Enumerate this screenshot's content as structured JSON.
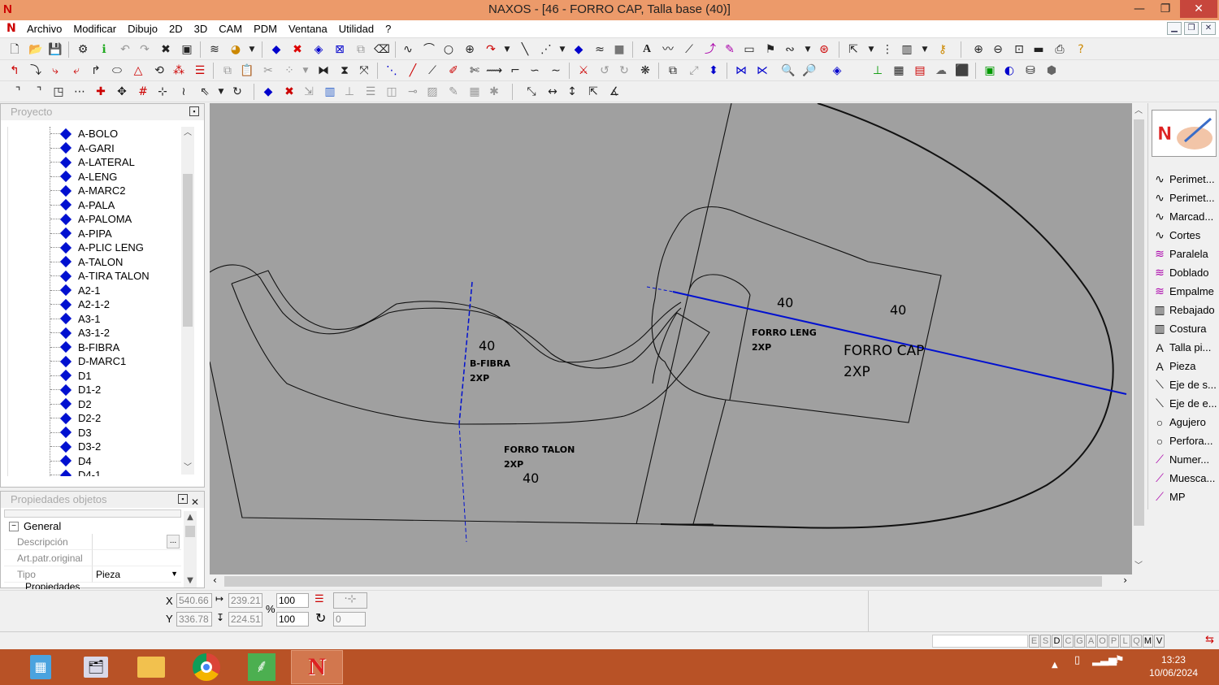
{
  "window": {
    "app_logo": "N",
    "title": "NAXOS - [46 - FORRO CAP, Talla base (40)]",
    "minimize": "—",
    "maximize": "❐",
    "close": "✕"
  },
  "menu": {
    "items": [
      "Archivo",
      "Modificar",
      "Dibujo",
      "2D",
      "3D",
      "CAM",
      "PDM",
      "Ventana",
      "Utilidad",
      "?"
    ]
  },
  "project_panel": {
    "title": "Proyecto",
    "items": [
      "A-BOLO",
      "A-GARI",
      "A-LATERAL",
      "A-LENG",
      "A-MARC2",
      "A-PALA",
      "A-PALOMA",
      "A-PIPA",
      "A-PLIC LENG",
      "A-TALON",
      "A-TIRA TALON",
      "A2-1",
      "A2-1-2",
      "A3-1",
      "A3-1-2",
      "B-FIBRA",
      "D-MARC1",
      "D1",
      "D1-2",
      "D2",
      "D2-2",
      "D3",
      "D3-2",
      "D4",
      "D4-1"
    ]
  },
  "properties_panel": {
    "title": "Propiedades objetos",
    "section": "General",
    "rows": [
      {
        "key": "Descripción",
        "value": ""
      },
      {
        "key": "Art.patr.original",
        "value": ""
      },
      {
        "key": "Tipo",
        "value": "Pieza"
      }
    ],
    "cut_row": "Propiedades"
  },
  "canvas_labels": {
    "bfibra_size": "40",
    "bfibra_name": "B-FIBRA",
    "bfibra_qty": "2XP",
    "talon_name": "FORRO TALON",
    "talon_qty": "2XP",
    "talon_size": "40",
    "leng_size": "40",
    "leng_name": "FORRO LENG",
    "leng_qty": "2XP",
    "cap_size": "40",
    "cap_name": "FORRO CAP",
    "cap_qty": "2XP"
  },
  "right_panel": {
    "items": [
      "Perimet...",
      "Perimet...",
      "Marcad...",
      "Cortes",
      "Paralela",
      "Doblado",
      "Empalme",
      "Rebajado",
      "Costura",
      "Talla pi...",
      "Pieza",
      "Eje de s...",
      "Eje de e...",
      "Agujero",
      "Perfora...",
      "Numer...",
      "Muesca...",
      "MP"
    ]
  },
  "coords": {
    "x_label": "X",
    "y_label": "Y",
    "x": "540.66",
    "y": "336.78",
    "w": "239.21",
    "h": "224.51",
    "pct_label": "%",
    "scale_x": "100",
    "scale_y": "100",
    "rotation": "0"
  },
  "status_flags": [
    "E",
    "S",
    "D",
    "C",
    "G",
    "A",
    "O",
    "P",
    "L",
    "Q",
    "M",
    "V"
  ],
  "clock": {
    "time": "13:23",
    "date": "10/06/2024"
  },
  "colors": {
    "canvas": "#a0a0a0",
    "titlebar": "#ec9a6a",
    "taskbar": "#b85226",
    "axis_line": "#0010d0"
  }
}
